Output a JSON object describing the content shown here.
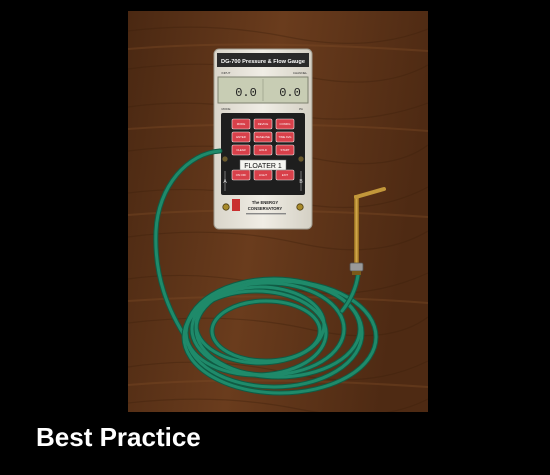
{
  "caption": "Best Practice",
  "gauge": {
    "model_title": "DG-700 Pressure & Flow Gauge",
    "channel_a_header": "INPUT",
    "channel_b_header": "CHANNEL",
    "reading_left": "0.0",
    "reading_right": "0.0",
    "lcd_sub_left": "MODE",
    "lcd_sub_right": "PA",
    "label_strip": "FLOATER 1",
    "brand_line1": "The ENERGY",
    "brand_line2": "CONSERVATORY",
    "port_a": "A",
    "port_b": "B",
    "keys": [
      "MODE",
      "DEVICE",
      "CONFIG",
      "ENTER",
      "BASELINE",
      "TIME AVG",
      "CLEAR",
      "HOLD",
      "START",
      "ON OFF",
      "LIGHT",
      "EXIT"
    ]
  },
  "colors": {
    "wood_base": "#5a3318",
    "wood_dark": "#3c1f0c",
    "hose": "#1f8a6a",
    "hose_dark": "#0f5c45",
    "probe": "#b8892a",
    "gauge_body": "#e9e6dd",
    "panel": "#1e1e1e",
    "key_red": "#d8404a",
    "lcd": "#c8cdb4"
  }
}
